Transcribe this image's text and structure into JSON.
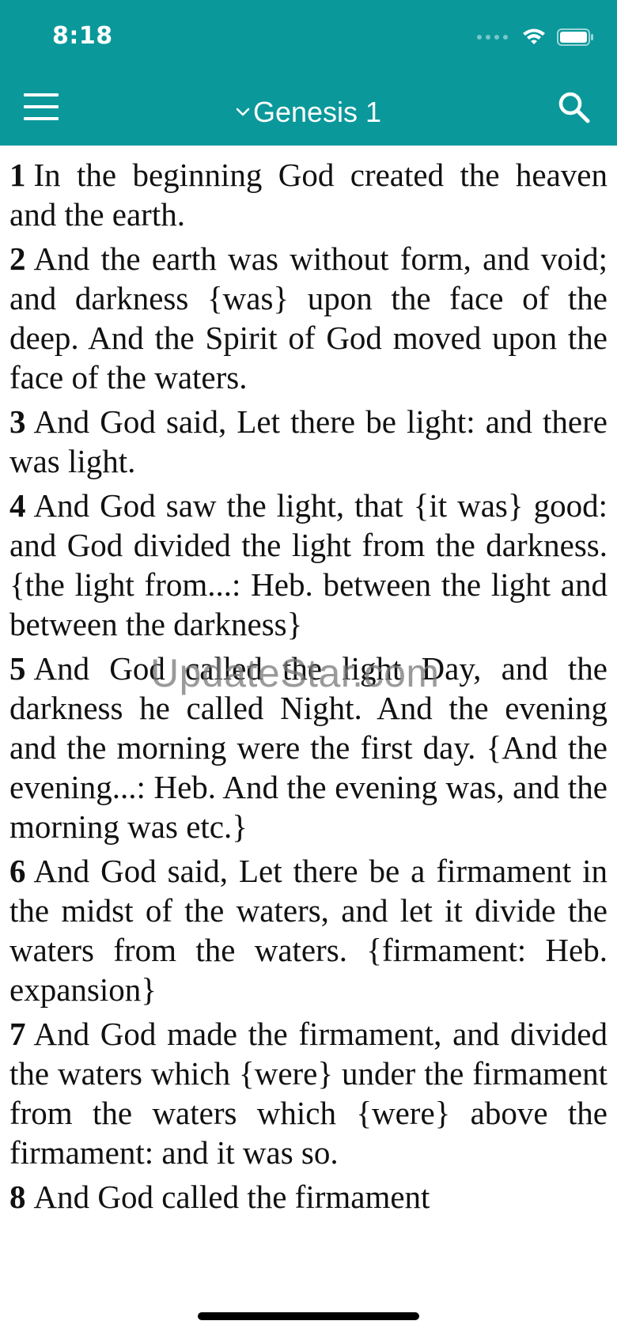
{
  "status_bar": {
    "time": "8:18",
    "icons": [
      "signal-icon",
      "wifi-icon",
      "battery-icon"
    ]
  },
  "nav": {
    "title": "Genesis 1",
    "menu_icon": "menu-icon",
    "search_icon": "search-icon",
    "chevron_icon": "chevron-down-icon"
  },
  "colors": {
    "header_background": "#0a989b",
    "text": "#111111"
  },
  "watermark": "UpdateStar.com",
  "verses": [
    {
      "num": "1",
      "text": "In the beginning God created the heaven and the earth."
    },
    {
      "num": "2",
      "text": "And the earth was without form, and void; and darkness {was} upon the face of the deep. And the Spirit of God moved upon the face of the waters."
    },
    {
      "num": "3",
      "text": "And God said, Let there be light: and there was light."
    },
    {
      "num": "4",
      "text": "And God saw the light, that {it was} good: and God divided the light from the darkness. {the light from...: Heb. between the light and between the darkness}"
    },
    {
      "num": "5",
      "text": "And God called the light Day, and the darkness he called Night. And the evening and the morning were the first day. {And the evening...: Heb. And the evening was, and the morning was etc.}"
    },
    {
      "num": "6",
      "text": "And God said, Let there be a firmament in the midst of the waters, and let it divide the waters from the waters. {firmament: Heb. expansion}"
    },
    {
      "num": "7",
      "text": "And God made the firmament, and divided the waters which {were} under the firmament from the waters which {were} above the firmament: and it was so."
    },
    {
      "num": "8",
      "text": "And God called the firmament"
    }
  ]
}
